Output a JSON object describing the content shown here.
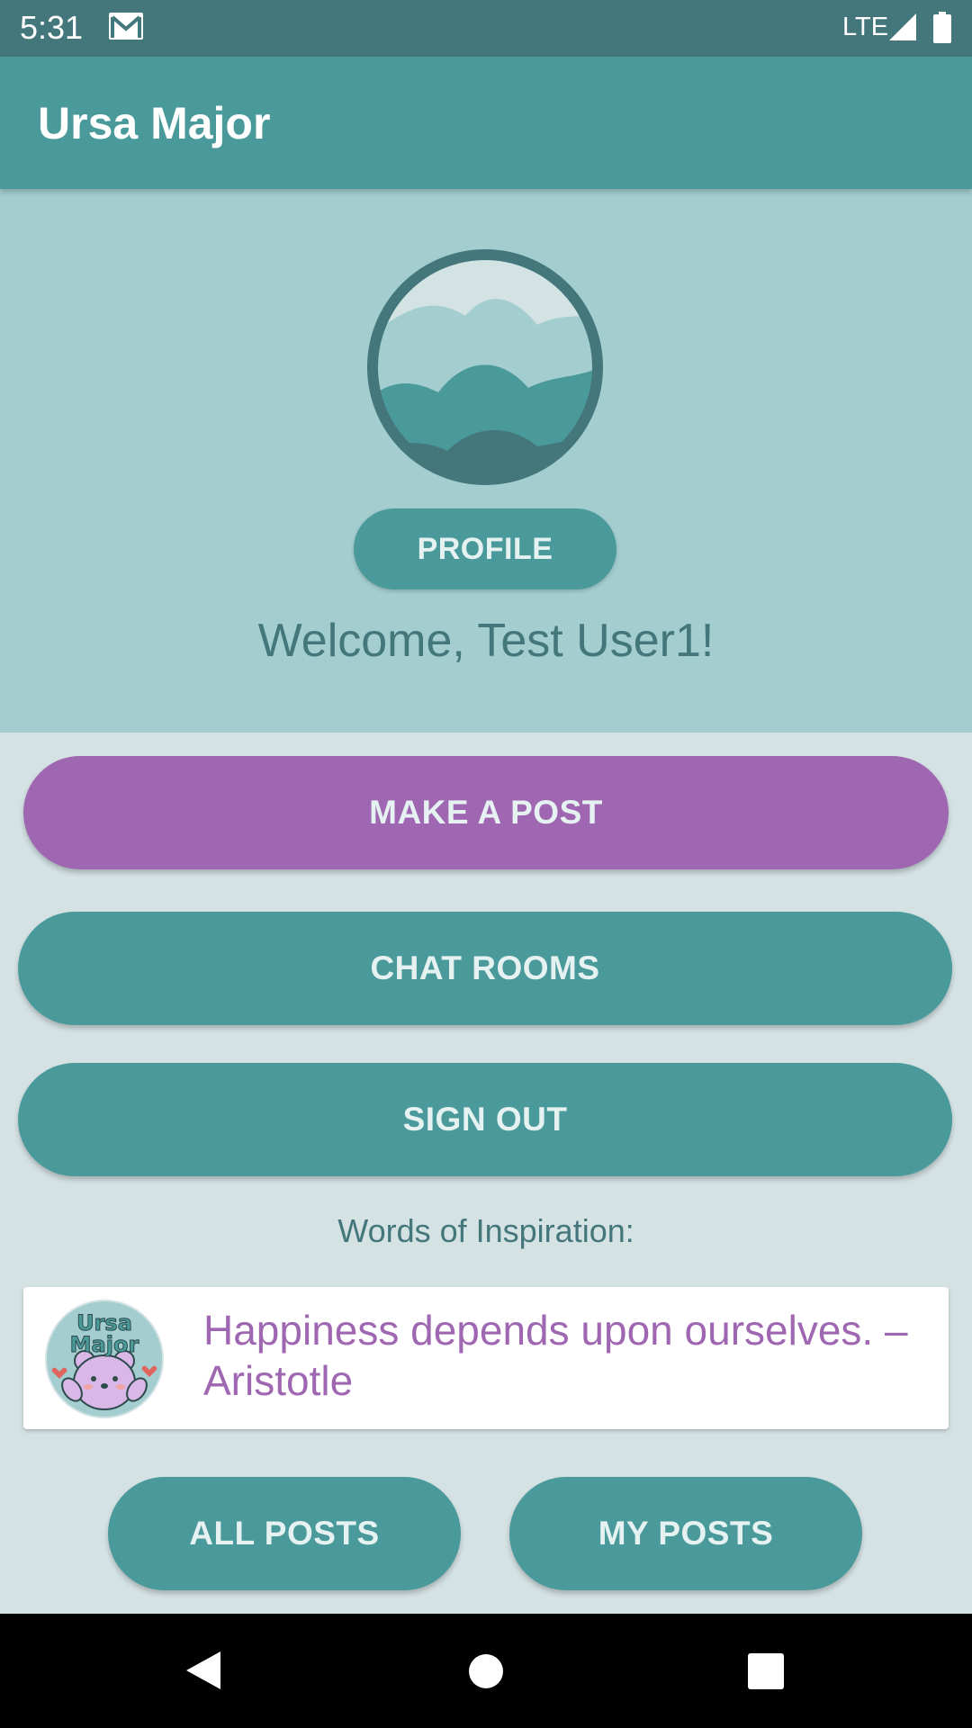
{
  "status_bar": {
    "time": "5:31",
    "network": "LTE",
    "icons": [
      "gmail-icon",
      "signal-icon",
      "battery-icon"
    ]
  },
  "app_bar": {
    "title": "Ursa Major"
  },
  "header": {
    "avatar_icon": "landscape-avatar-icon",
    "profile_button": "PROFILE",
    "welcome": "Welcome, Test User1!"
  },
  "actions": {
    "make_post": "MAKE A POST",
    "chat_rooms": "CHAT ROOMS",
    "sign_out": "SIGN OUT"
  },
  "inspiration": {
    "label": "Words of Inspiration:",
    "logo_icon": "ursa-major-bear-logo",
    "logo_text": "Ursa Major",
    "quote": "Happiness depends upon ourselves. – Aristotle"
  },
  "bottom_buttons": {
    "all_posts": "ALL POSTS",
    "my_posts": "MY POSTS"
  },
  "nav_bar": {
    "icons": [
      "back-icon",
      "home-icon",
      "recents-icon"
    ]
  },
  "colors": {
    "status_bar": "#43777b",
    "primary": "#4a9a9b",
    "header_bg": "#a3cdcf",
    "page_bg": "#d5e2e4",
    "accent_purple": "#9f67b1",
    "text_dark_teal": "#43777b"
  }
}
